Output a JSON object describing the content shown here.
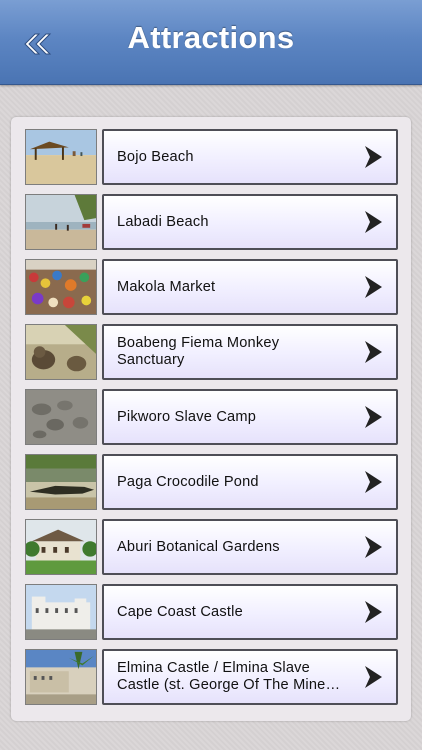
{
  "navbar": {
    "title": "Attractions",
    "back_icon": "double-chevron-left-icon",
    "colors": {
      "bar": "#5d86c3",
      "title": "#ffffff"
    }
  },
  "list": {
    "items": [
      {
        "label": "Bojo Beach",
        "thumb_icon": "beach-photo",
        "arrow_icon": "chevron-right-icon"
      },
      {
        "label": "Labadi Beach",
        "thumb_icon": "beach-photo",
        "arrow_icon": "chevron-right-icon"
      },
      {
        "label": "Makola Market",
        "thumb_icon": "market-photo",
        "arrow_icon": "chevron-right-icon"
      },
      {
        "label": "Boabeng Fiema Monkey Sanctuary",
        "thumb_icon": "monkey-photo",
        "arrow_icon": "chevron-right-icon"
      },
      {
        "label": "Pikworo Slave Camp",
        "thumb_icon": "rock-photo",
        "arrow_icon": "chevron-right-icon"
      },
      {
        "label": "Paga Crocodile Pond",
        "thumb_icon": "crocodile-photo",
        "arrow_icon": "chevron-right-icon"
      },
      {
        "label": "Aburi Botanical Gardens",
        "thumb_icon": "garden-photo",
        "arrow_icon": "chevron-right-icon"
      },
      {
        "label": "Cape Coast Castle",
        "thumb_icon": "castle-photo",
        "arrow_icon": "chevron-right-icon"
      },
      {
        "label": "Elmina Castle / Elmina Slave Castle (st. George Of The Mine…",
        "thumb_icon": "castle-photo",
        "arrow_icon": "chevron-right-icon"
      }
    ]
  }
}
